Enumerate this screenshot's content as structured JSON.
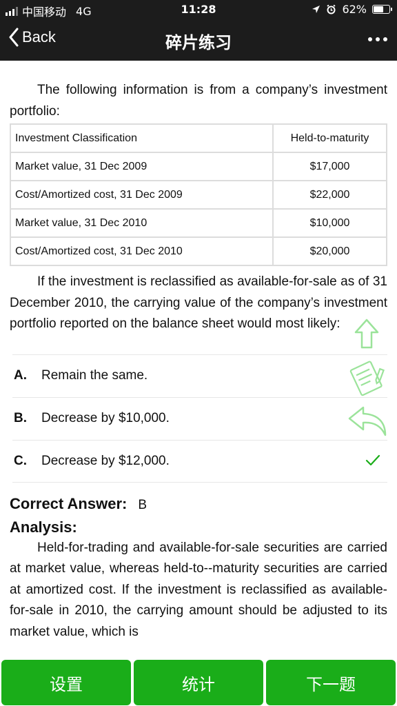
{
  "status": {
    "carrier": "中国移动",
    "network": "4G",
    "time": "11:28",
    "battery_text": "62%",
    "battery_level": 0.62
  },
  "nav": {
    "back_label": "Back",
    "title": "碎片练习"
  },
  "question": {
    "intro": "The following information is from a company’s investment portfolio:",
    "table": {
      "headers": [
        "Investment Classification",
        "Held-to-maturity"
      ],
      "rows": [
        [
          "Market value, 31 Dec 2009",
          "$17,000"
        ],
        [
          "Cost/Amortized cost, 31 Dec 2009",
          "$22,000"
        ],
        [
          "Market value, 31 Dec 2010",
          "$10,000"
        ],
        [
          "Cost/Amortized cost, 31 Dec 2010",
          "$20,000"
        ]
      ]
    },
    "stem": "If the investment is reclassified as available-for-sale as of 31 December 2010, the carrying value of the company’s investment portfolio reported on the balance sheet would most likely:"
  },
  "options": [
    {
      "letter": "A.",
      "text": "Remain the same."
    },
    {
      "letter": "B.",
      "text": "Decrease by $10,000."
    },
    {
      "letter": "C.",
      "text": "Decrease by $12,000."
    }
  ],
  "answer": {
    "label": "Correct Answer:",
    "value": "B",
    "analysis_title": "Analysis:",
    "analysis_text": "Held-for-trading and available-for-sale securities are carried at market value, whereas held-to--maturity securities are carried at amortized cost. If the investment is reclassified as available-for-sale in 2010, the carrying amount should be adjusted to its market value, which is"
  },
  "bottom": {
    "settings": "设置",
    "stats": "统计",
    "next": "下一题"
  },
  "colors": {
    "bar_bg": "#1c1c1c",
    "accent_green": "#1aad19",
    "float_icon_green": "#9be39a"
  }
}
